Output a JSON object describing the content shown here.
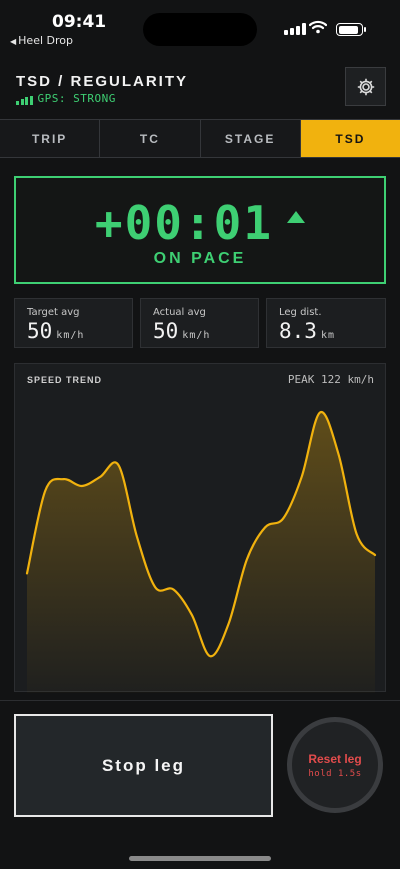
{
  "status_bar": {
    "time": "09:41",
    "back_label": "Heel Drop"
  },
  "header": {
    "title": "TSD / REGULARITY",
    "gps_status": "GPS: STRONG",
    "settings_icon": "gear-icon"
  },
  "tabs": [
    {
      "label": "TRIP",
      "active": false
    },
    {
      "label": "TC",
      "active": false
    },
    {
      "label": "STAGE",
      "active": false
    },
    {
      "label": "TSD",
      "active": true
    }
  ],
  "delta": {
    "value": "+00:01",
    "status": "ON PACE",
    "trend_icon": "up-triangle-icon",
    "color": "#3ecf73"
  },
  "stats": [
    {
      "label": "Target avg",
      "value": "50",
      "unit": "km/h"
    },
    {
      "label": "Actual avg",
      "value": "50",
      "unit": "km/h"
    },
    {
      "label": "Leg dist.",
      "value": "8.3",
      "unit": "km"
    }
  ],
  "speed_trend": {
    "title": "SPEED TREND",
    "peak_label": "PEAK 122 km/h",
    "line_color": "#f1b20e",
    "values": [
      52,
      88,
      93,
      90,
      94,
      99,
      68,
      46,
      45,
      34,
      16,
      30,
      58,
      72,
      76,
      94,
      122,
      104,
      69,
      60
    ],
    "ymax": 130
  },
  "controls": {
    "stop_label": "Stop leg",
    "reset_label": "Reset leg",
    "reset_hint": "hold 1.5s"
  },
  "colors": {
    "accent": "#f1b20e",
    "ok": "#3ecf73",
    "danger": "#e24c4c"
  }
}
